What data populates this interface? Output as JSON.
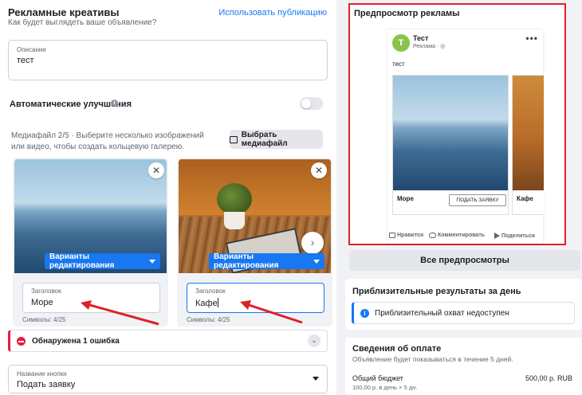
{
  "creatives": {
    "title": "Рекламные креативы",
    "subtitle": "Как будет выглядеть ваше объявление?",
    "use_publication": "Использовать публикацию"
  },
  "description": {
    "label": "Описание",
    "value": "тест"
  },
  "auto_improvements": {
    "label": "Автоматические улучшения",
    "info_icon": "i",
    "enabled": false
  },
  "media": {
    "info": "Медиафайл 2/5 · Выберите несколько изображений или видео, чтобы создать кольцевую галерею.",
    "choose_button": "Выбрать медиафайл"
  },
  "cards": [
    {
      "edit_button": "Варианты редактирования",
      "headline_label": "Заголовок",
      "headline_value": "Море",
      "chars": "Символы: 4/25",
      "close": "✕"
    },
    {
      "edit_button": "Варианты редактирования",
      "headline_label": "Заголовок",
      "headline_value": "Кафе",
      "chars": "Символы: 4/25",
      "close": "✕",
      "next": "›"
    }
  ],
  "error": {
    "text": "Обнаружена 1 ошибка",
    "chevron": "⌄"
  },
  "cta_field": {
    "label": "Название кнопки",
    "value": "Подать заявку"
  },
  "preview": {
    "title": "Предпросмотр рекламы",
    "avatar_letter": "T",
    "page_name": "Тест",
    "meta": "Реклама · ◎",
    "dots": "•••",
    "text": "тест",
    "carousel": [
      {
        "title": "Море",
        "button": "ПОДАТЬ ЗАЯВКУ"
      },
      {
        "title": "Кафе"
      }
    ],
    "reactions": {
      "like": "Нравится",
      "comment": "Комментировать",
      "share": "Поделиться"
    }
  },
  "all_previews": "Все предпросмотры",
  "results": {
    "title": "Приблизительные результаты за день",
    "reach_icon": "i",
    "reach_text": "Приблизительный охват недоступен"
  },
  "payment": {
    "title": "Сведения об оплате",
    "subtitle": "Объявление будет показываться в течение 5 дней.",
    "budget_label": "Общий бюджет",
    "budget_value": "500,00 р. RUB",
    "detail": "100,00 р. в день × 5 дн."
  },
  "colors": {
    "accent": "#1877f2",
    "error": "#e41e3f",
    "highlight_border": "#e0202b",
    "arrow": "#d9232a"
  }
}
